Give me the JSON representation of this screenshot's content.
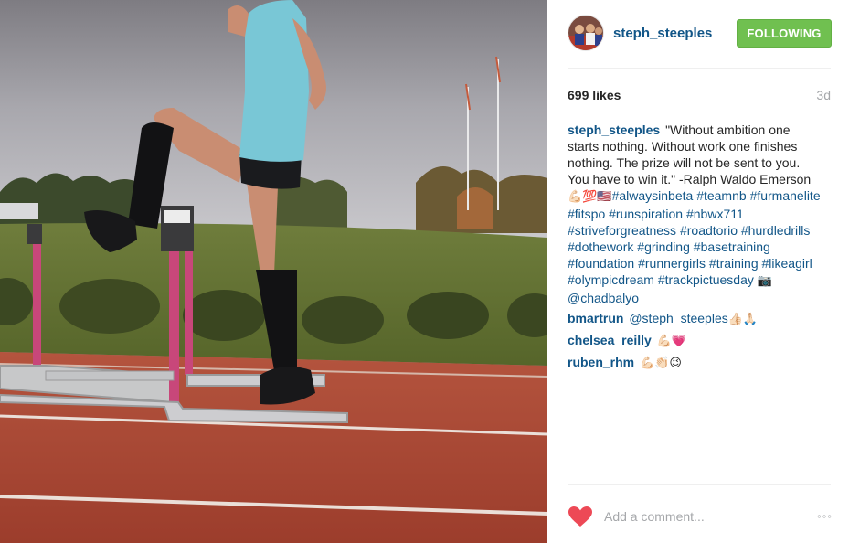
{
  "post": {
    "username": "steph_steeples",
    "follow_label": "FOLLOWING",
    "likes": "699 likes",
    "time_ago": "3d"
  },
  "caption": {
    "username": "steph_steeples",
    "quote": "\"Without ambition one starts nothing. Without work one finishes nothing. The prize will not be sent to you. You have to win it.\" -Ralph Waldo Emerson",
    "emojis_a": "💪🏻💯🇺🇸",
    "tags_a": [
      "#alwaysinbeta",
      "#teamnb",
      "#furmanelite",
      "#fitspo",
      "#runspiration",
      "#nbwx711",
      "#striveforgreatness",
      "#roadtorio",
      "#hurdledrills",
      "#dothework",
      "#grinding",
      "#basetraining",
      "#foundation",
      "#runnergirls",
      "#training",
      "#likeagirl",
      "#olympicdream",
      "#trackpictuesday"
    ],
    "camera": "📷",
    "mention": "@chadbalyo"
  },
  "comments": [
    {
      "username": "bmartrun",
      "mention": "@steph_steeples",
      "text": "👍🏻🙏🏻",
      "emoji": "👍🏻🙏🏻"
    },
    {
      "username": "chelsea_reilly",
      "text": "💪🏻💗"
    },
    {
      "username": "ruben_rhm",
      "text": "💪🏻👏🏻😉"
    }
  ],
  "comment_box": {
    "placeholder": "Add a comment..."
  },
  "icons": {
    "like": "heart-icon",
    "more": "more-options-icon",
    "avatar": "profile-avatar"
  },
  "colors": {
    "link": "#125688",
    "follow_button": "#70c050",
    "heart": "#ed4956",
    "muted": "#a5a7aa"
  }
}
